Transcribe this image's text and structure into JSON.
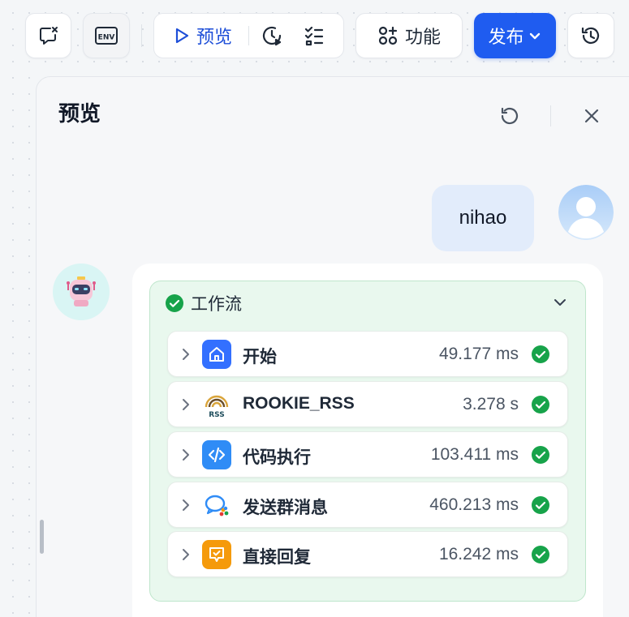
{
  "toolbar": {
    "preview_label": "预览",
    "function_label": "功能",
    "publish_label": "发布",
    "env_label": "ENV"
  },
  "panel": {
    "title": "预览"
  },
  "chat": {
    "user_message": "nihao",
    "workflow": {
      "title": "工作流",
      "status": "success",
      "steps": [
        {
          "name": "开始",
          "time": "49.177 ms",
          "icon": "home-icon",
          "color": "#3370ff"
        },
        {
          "name": "ROOKIE_RSS",
          "time": "3.278 s",
          "icon": "rss-icon",
          "color": "#ffffff"
        },
        {
          "name": "代码执行",
          "time": "103.411 ms",
          "icon": "code-icon",
          "color": "#2f8cf6"
        },
        {
          "name": "发送群消息",
          "time": "460.213 ms",
          "icon": "wecom-icon",
          "color": "#ffffff"
        },
        {
          "name": "直接回复",
          "time": "16.242 ms",
          "icon": "reply-icon",
          "color": "#f59a0b"
        }
      ]
    }
  },
  "colors": {
    "accent": "#1f5cf0",
    "success": "#17a34a",
    "workflow_bg": "#e9f8ee",
    "user_bubble": "#e2ecfb"
  }
}
